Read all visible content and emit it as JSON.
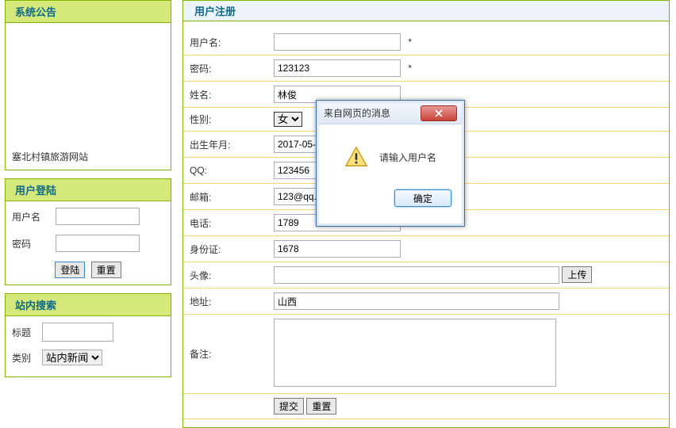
{
  "sidebar": {
    "announce": {
      "title": "系统公告",
      "siteName": "塞北村镇旅游网站"
    },
    "login": {
      "title": "用户登陆",
      "userLabel": "用户名",
      "passLabel": "密码",
      "loginBtn": "登陆",
      "resetBtn": "重置"
    },
    "search": {
      "title": "站内搜索",
      "titleLabel": "标题",
      "catLabel": "类别",
      "catValue": "站内新闻"
    }
  },
  "register": {
    "title": "用户注册",
    "rows": {
      "username": {
        "label": "用户名:",
        "value": "",
        "star": "*"
      },
      "password": {
        "label": "密码:",
        "value": "123123",
        "star": "*"
      },
      "name": {
        "label": "姓名:",
        "value": "林俊"
      },
      "gender": {
        "label": "性别:",
        "value": "女"
      },
      "birth": {
        "label": "出生年月:",
        "value": "2017-05-"
      },
      "qq": {
        "label": "QQ:",
        "value": "123456"
      },
      "email": {
        "label": "邮箱:",
        "value": "123@qq.c"
      },
      "phone": {
        "label": "电话:",
        "value": "1789"
      },
      "idcard": {
        "label": "身份证:",
        "value": "1678"
      },
      "avatar": {
        "label": "头像:",
        "value": "",
        "uploadBtn": "上传"
      },
      "address": {
        "label": "地址:",
        "value": "山西"
      },
      "remark": {
        "label": "备注:",
        "value": ""
      }
    },
    "submitBtn": "提交",
    "resetBtn": "重置"
  },
  "dialog": {
    "title": "来自网页的消息",
    "message": "请输入用户名",
    "ok": "确定"
  }
}
